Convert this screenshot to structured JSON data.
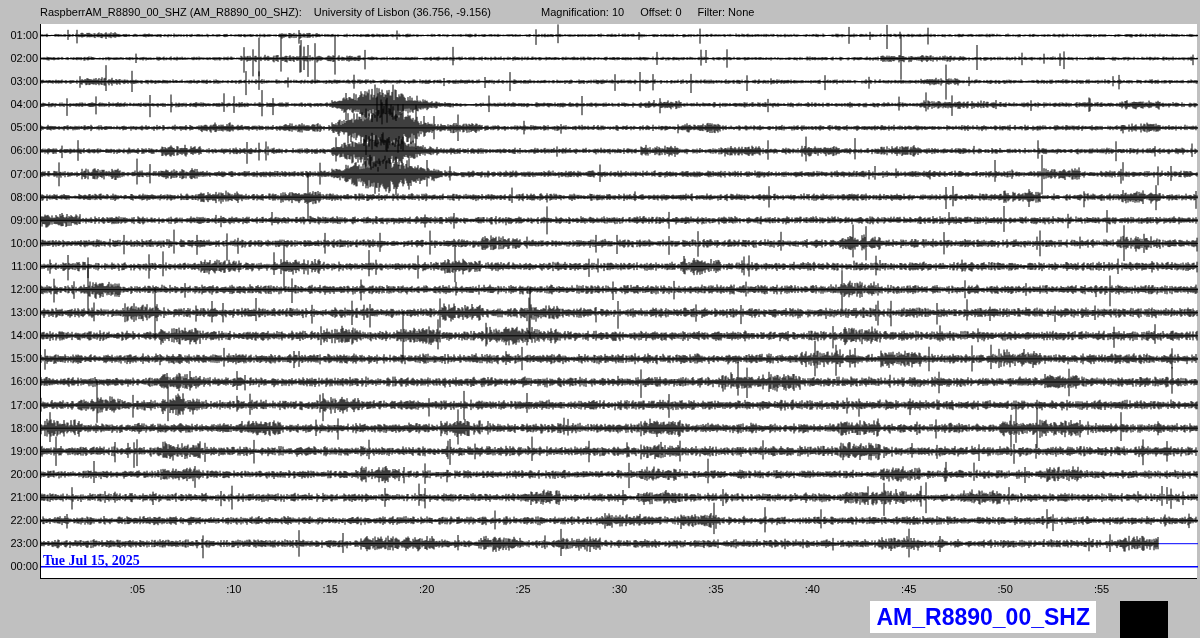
{
  "header": {
    "station": "RaspberrAM_R8890_00_SHZ (AM_R8890_00_SHZ):",
    "location": "University of Lisbon (36.756, -9.156)",
    "magnification": "Magnification: 10",
    "offset": "Offset: 0",
    "filter": "Filter: None"
  },
  "rows": [
    {
      "label": "01:00",
      "kind": "trace",
      "level": 1
    },
    {
      "label": "02:00",
      "kind": "trace",
      "level": 1
    },
    {
      "label": "03:00",
      "kind": "trace",
      "level": 1
    },
    {
      "label": "04:00",
      "kind": "trace",
      "level": 1
    },
    {
      "label": "05:00",
      "kind": "trace",
      "level": 1
    },
    {
      "label": "06:00",
      "kind": "trace",
      "level": 1
    },
    {
      "label": "07:00",
      "kind": "trace",
      "level": 1
    },
    {
      "label": "08:00",
      "kind": "trace",
      "level": 1
    },
    {
      "label": "09:00",
      "kind": "trace",
      "level": 1
    },
    {
      "label": "10:00",
      "kind": "trace",
      "level": 1
    },
    {
      "label": "11:00",
      "kind": "trace",
      "level": 1
    },
    {
      "label": "12:00",
      "kind": "trace",
      "level": 1
    },
    {
      "label": "13:00",
      "kind": "trace",
      "level": 1
    },
    {
      "label": "14:00",
      "kind": "trace",
      "level": 1
    },
    {
      "label": "15:00",
      "kind": "trace",
      "level": 1
    },
    {
      "label": "16:00",
      "kind": "trace",
      "level": 1
    },
    {
      "label": "17:00",
      "kind": "trace",
      "level": 1
    },
    {
      "label": "18:00",
      "kind": "trace",
      "level": 1
    },
    {
      "label": "19:00",
      "kind": "trace",
      "level": 1
    },
    {
      "label": "20:00",
      "kind": "trace",
      "level": 1
    },
    {
      "label": "21:00",
      "kind": "trace",
      "level": 1
    },
    {
      "label": "22:00",
      "kind": "trace",
      "level": 1
    },
    {
      "label": "23:00",
      "kind": "trace",
      "level": 0.966
    },
    {
      "label": "00:00",
      "kind": "empty"
    }
  ],
  "date_label": "Tue Jul 15, 2025",
  "minute_ticks": [
    ":05",
    ":10",
    ":15",
    ":20",
    ":25",
    ":30",
    ":35",
    ":40",
    ":45",
    ":50",
    ":55"
  ],
  "station_label": "AM_R8890_00_SHZ"
}
